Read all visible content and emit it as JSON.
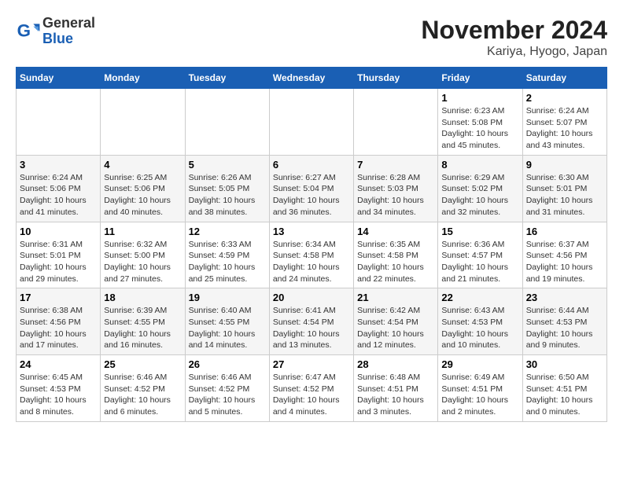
{
  "header": {
    "logo_line1": "General",
    "logo_line2": "Blue",
    "title": "November 2024",
    "subtitle": "Kariya, Hyogo, Japan"
  },
  "weekdays": [
    "Sunday",
    "Monday",
    "Tuesday",
    "Wednesday",
    "Thursday",
    "Friday",
    "Saturday"
  ],
  "weeks": [
    [
      {
        "day": "",
        "info": ""
      },
      {
        "day": "",
        "info": ""
      },
      {
        "day": "",
        "info": ""
      },
      {
        "day": "",
        "info": ""
      },
      {
        "day": "",
        "info": ""
      },
      {
        "day": "1",
        "info": "Sunrise: 6:23 AM\nSunset: 5:08 PM\nDaylight: 10 hours\nand 45 minutes."
      },
      {
        "day": "2",
        "info": "Sunrise: 6:24 AM\nSunset: 5:07 PM\nDaylight: 10 hours\nand 43 minutes."
      }
    ],
    [
      {
        "day": "3",
        "info": "Sunrise: 6:24 AM\nSunset: 5:06 PM\nDaylight: 10 hours\nand 41 minutes."
      },
      {
        "day": "4",
        "info": "Sunrise: 6:25 AM\nSunset: 5:06 PM\nDaylight: 10 hours\nand 40 minutes."
      },
      {
        "day": "5",
        "info": "Sunrise: 6:26 AM\nSunset: 5:05 PM\nDaylight: 10 hours\nand 38 minutes."
      },
      {
        "day": "6",
        "info": "Sunrise: 6:27 AM\nSunset: 5:04 PM\nDaylight: 10 hours\nand 36 minutes."
      },
      {
        "day": "7",
        "info": "Sunrise: 6:28 AM\nSunset: 5:03 PM\nDaylight: 10 hours\nand 34 minutes."
      },
      {
        "day": "8",
        "info": "Sunrise: 6:29 AM\nSunset: 5:02 PM\nDaylight: 10 hours\nand 32 minutes."
      },
      {
        "day": "9",
        "info": "Sunrise: 6:30 AM\nSunset: 5:01 PM\nDaylight: 10 hours\nand 31 minutes."
      }
    ],
    [
      {
        "day": "10",
        "info": "Sunrise: 6:31 AM\nSunset: 5:01 PM\nDaylight: 10 hours\nand 29 minutes."
      },
      {
        "day": "11",
        "info": "Sunrise: 6:32 AM\nSunset: 5:00 PM\nDaylight: 10 hours\nand 27 minutes."
      },
      {
        "day": "12",
        "info": "Sunrise: 6:33 AM\nSunset: 4:59 PM\nDaylight: 10 hours\nand 25 minutes."
      },
      {
        "day": "13",
        "info": "Sunrise: 6:34 AM\nSunset: 4:58 PM\nDaylight: 10 hours\nand 24 minutes."
      },
      {
        "day": "14",
        "info": "Sunrise: 6:35 AM\nSunset: 4:58 PM\nDaylight: 10 hours\nand 22 minutes."
      },
      {
        "day": "15",
        "info": "Sunrise: 6:36 AM\nSunset: 4:57 PM\nDaylight: 10 hours\nand 21 minutes."
      },
      {
        "day": "16",
        "info": "Sunrise: 6:37 AM\nSunset: 4:56 PM\nDaylight: 10 hours\nand 19 minutes."
      }
    ],
    [
      {
        "day": "17",
        "info": "Sunrise: 6:38 AM\nSunset: 4:56 PM\nDaylight: 10 hours\nand 17 minutes."
      },
      {
        "day": "18",
        "info": "Sunrise: 6:39 AM\nSunset: 4:55 PM\nDaylight: 10 hours\nand 16 minutes."
      },
      {
        "day": "19",
        "info": "Sunrise: 6:40 AM\nSunset: 4:55 PM\nDaylight: 10 hours\nand 14 minutes."
      },
      {
        "day": "20",
        "info": "Sunrise: 6:41 AM\nSunset: 4:54 PM\nDaylight: 10 hours\nand 13 minutes."
      },
      {
        "day": "21",
        "info": "Sunrise: 6:42 AM\nSunset: 4:54 PM\nDaylight: 10 hours\nand 12 minutes."
      },
      {
        "day": "22",
        "info": "Sunrise: 6:43 AM\nSunset: 4:53 PM\nDaylight: 10 hours\nand 10 minutes."
      },
      {
        "day": "23",
        "info": "Sunrise: 6:44 AM\nSunset: 4:53 PM\nDaylight: 10 hours\nand 9 minutes."
      }
    ],
    [
      {
        "day": "24",
        "info": "Sunrise: 6:45 AM\nSunset: 4:53 PM\nDaylight: 10 hours\nand 8 minutes."
      },
      {
        "day": "25",
        "info": "Sunrise: 6:46 AM\nSunset: 4:52 PM\nDaylight: 10 hours\nand 6 minutes."
      },
      {
        "day": "26",
        "info": "Sunrise: 6:46 AM\nSunset: 4:52 PM\nDaylight: 10 hours\nand 5 minutes."
      },
      {
        "day": "27",
        "info": "Sunrise: 6:47 AM\nSunset: 4:52 PM\nDaylight: 10 hours\nand 4 minutes."
      },
      {
        "day": "28",
        "info": "Sunrise: 6:48 AM\nSunset: 4:51 PM\nDaylight: 10 hours\nand 3 minutes."
      },
      {
        "day": "29",
        "info": "Sunrise: 6:49 AM\nSunset: 4:51 PM\nDaylight: 10 hours\nand 2 minutes."
      },
      {
        "day": "30",
        "info": "Sunrise: 6:50 AM\nSunset: 4:51 PM\nDaylight: 10 hours\nand 0 minutes."
      }
    ]
  ]
}
